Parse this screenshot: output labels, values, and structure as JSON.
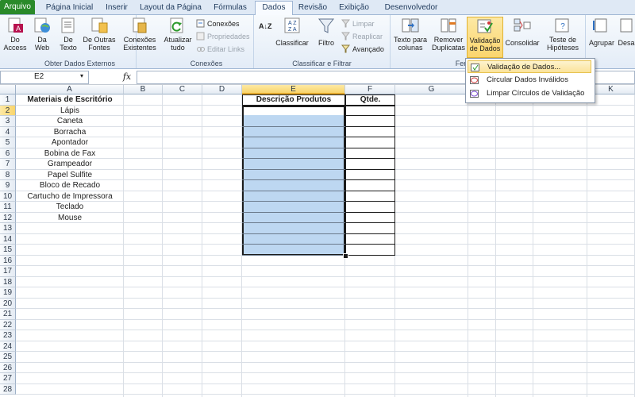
{
  "tabs": [
    "Arquivo",
    "Página Inicial",
    "Inserir",
    "Layout da Página",
    "Fórmulas",
    "Dados",
    "Revisão",
    "Exibição",
    "Desenvolvedor"
  ],
  "active_tab": "Dados",
  "ribbon": {
    "groups": {
      "external": "Obter Dados Externos",
      "connections": "Conexões",
      "sort": "Classificar e Filtrar",
      "tools": "Ferra"
    },
    "buttons": {
      "access": "Do Access",
      "web": "Da Web",
      "text": "De Texto",
      "other": "De Outras Fontes",
      "existing": "Conexões Existentes",
      "refresh": "Atualizar tudo",
      "conexoes": "Conexões",
      "propriedades": "Propriedades",
      "editar_links": "Editar Links",
      "sort_az": "A↓Z",
      "classificar": "Classificar",
      "filtro": "Filtro",
      "limpar": "Limpar",
      "reaplicar": "Reaplicar",
      "avancado": "Avançado",
      "texto_colunas": "Texto para colunas",
      "remover_dup": "Remover Duplicatas",
      "validacao": "Validação de Dados",
      "consolidar": "Consolidar",
      "teste_hipoteses": "Teste de Hipóteses",
      "agrupar": "Agrupar",
      "desagrupar": "Desa"
    }
  },
  "dropdown": {
    "items": [
      "Validação de Dados...",
      "Circular Dados Inválidos",
      "Limpar Círculos de Validação"
    ]
  },
  "formula_bar": {
    "name_box": "E2",
    "fx": "fx",
    "formula": ""
  },
  "sheet": {
    "columns": [
      "A",
      "B",
      "C",
      "D",
      "E",
      "F",
      "G",
      "H",
      "I",
      "J",
      "K"
    ],
    "rows": [
      "1",
      "2",
      "3",
      "4",
      "5",
      "6",
      "7",
      "8",
      "9",
      "10",
      "11",
      "12",
      "13",
      "14",
      "15",
      "16",
      "17",
      "18",
      "19",
      "20",
      "21",
      "22",
      "23",
      "24",
      "25",
      "26",
      "27",
      "28"
    ],
    "header_a": "Materiais de Escritório",
    "header_e": "Descrição Produtos",
    "header_f": "Qtde.",
    "items": [
      "Lápis",
      "Caneta",
      "Borracha",
      "Apontador",
      "Bobina de Fax",
      "Grampeador",
      "Papel Sulfite",
      "Bloco de Recado",
      "Cartucho de Impressora",
      "Teclado",
      "Mouse"
    ]
  },
  "colors": {
    "selection_fill": "#bdd7f1",
    "active_tab": "#2a8a2a"
  }
}
